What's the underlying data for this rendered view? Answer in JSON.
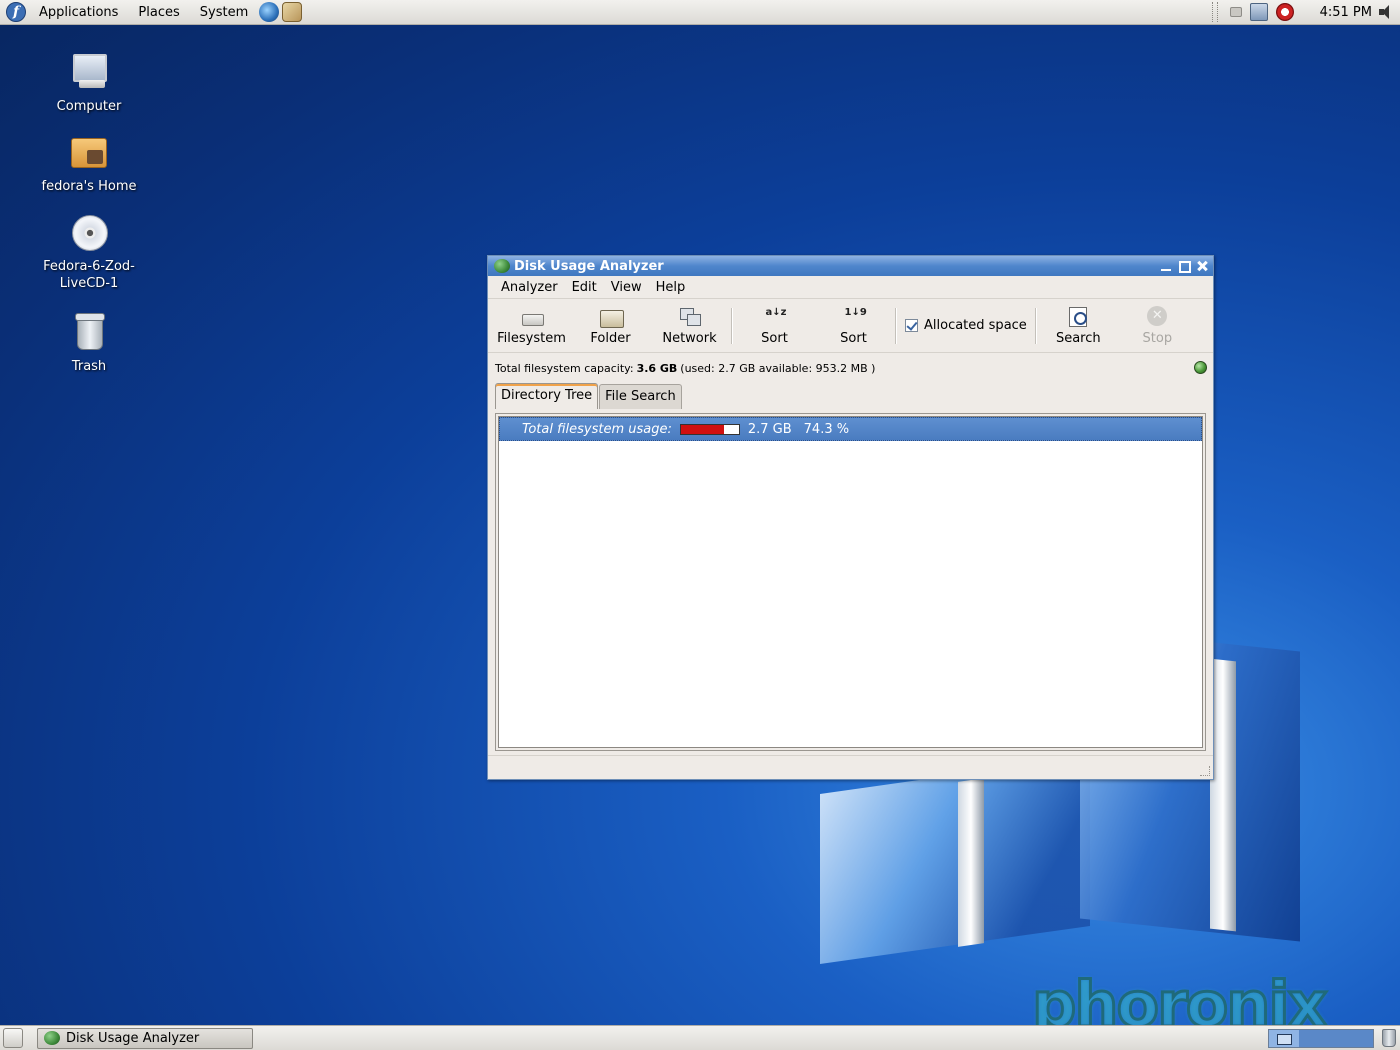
{
  "top_panel": {
    "menus": [
      "Applications",
      "Places",
      "System"
    ],
    "clock": "4:51 PM",
    "icons": [
      "fedora-logo",
      "web-browser-icon",
      "mail-icon",
      "tray-network-icon",
      "tray-update-icon",
      "tray-blocked-icon",
      "volume-icon"
    ]
  },
  "desktop": {
    "icons": [
      {
        "label": "Computer",
        "icon": "computer-icon"
      },
      {
        "label": "fedora's Home",
        "icon": "home-folder-icon"
      },
      {
        "label": "Fedora-6-Zod-LiveCD-1",
        "icon": "cd-icon"
      },
      {
        "label": "Trash",
        "icon": "trash-icon"
      }
    ],
    "watermark": "phoronix"
  },
  "window": {
    "title": "Disk Usage Analyzer",
    "menu": [
      "Analyzer",
      "Edit",
      "View",
      "Help"
    ],
    "toolbar": {
      "filesystem": "Filesystem",
      "folder": "Folder",
      "network": "Network",
      "sort_name": "Sort",
      "sort_size": "Sort",
      "allocated_space": "Allocated space",
      "allocated_checked": true,
      "search": "Search",
      "stop": "Stop"
    },
    "capacity": {
      "prefix": "Total filesystem capacity:",
      "total": "3.6 GB",
      "details": "(used: 2.7 GB available: 953.2 MB )"
    },
    "tabs": [
      "Directory Tree",
      "File Search"
    ],
    "active_tab": "Directory Tree",
    "tree": {
      "label": "Total filesystem usage:",
      "size": "2.7 GB",
      "percent": "74.3 %",
      "usage_fraction": 0.743
    },
    "colors": {
      "selection": "#4a7cc0",
      "usage_bar": "#d01010",
      "titlebar": "#4f86cc"
    }
  },
  "taskbar": {
    "task_label": "Disk Usage Analyzer"
  }
}
